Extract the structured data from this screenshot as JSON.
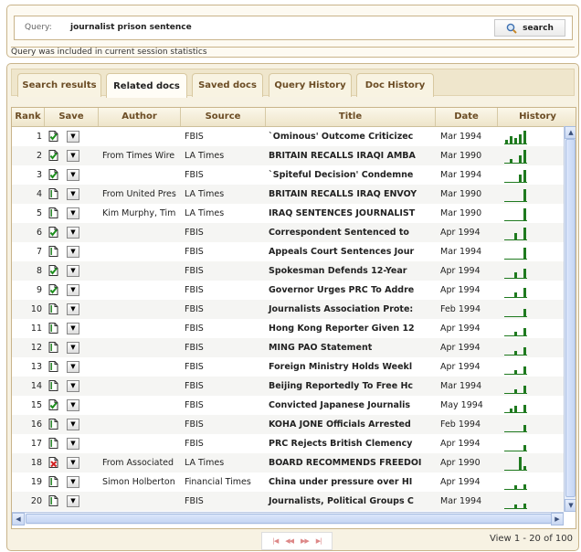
{
  "query": {
    "label": "Query:",
    "value": "journalist prison sentence",
    "search_label": "search",
    "status": "Query was included in current session statistics"
  },
  "tabs": [
    {
      "label": "Search results",
      "active": false
    },
    {
      "label": "Related docs",
      "active": true
    },
    {
      "label": "Saved docs",
      "active": false
    },
    {
      "label": "Query History",
      "active": false
    },
    {
      "label": "Doc History",
      "active": false
    }
  ],
  "columns": [
    "Rank",
    "Save",
    "Author",
    "Source",
    "Title",
    "Date",
    "History"
  ],
  "rows": [
    {
      "rank": "1",
      "saved": "saved",
      "author": "",
      "source": "FBIS",
      "title": "`Ominous' Outcome Criticizec",
      "date": "Mar 1994",
      "history": [
        4,
        8,
        6,
        10,
        14
      ]
    },
    {
      "rank": "2",
      "saved": "saved",
      "author": "From Times Wire",
      "source": "LA Times",
      "title": "BRITAIN RECALLS IRAQI AMBA",
      "date": "Mar 1990",
      "history": [
        0,
        4,
        0,
        8,
        14
      ]
    },
    {
      "rank": "3",
      "saved": "saved",
      "author": "",
      "source": "FBIS",
      "title": "`Spiteful Decision' Condemne",
      "date": "Mar 1994",
      "history": [
        0,
        0,
        0,
        8,
        13
      ]
    },
    {
      "rank": "4",
      "saved": "unsaved",
      "author": "From United Pres",
      "source": "LA Times",
      "title": "BRITAIN RECALLS IRAQ ENVOY",
      "date": "Mar 1990",
      "history": [
        0,
        0,
        0,
        0,
        13
      ]
    },
    {
      "rank": "5",
      "saved": "unsaved",
      "author": "Kim Murphy, Tim",
      "source": "LA Times",
      "title": "IRAQ SENTENCES JOURNALIST",
      "date": "Mar 1990",
      "history": [
        0,
        0,
        0,
        0,
        13
      ]
    },
    {
      "rank": "6",
      "saved": "saved",
      "author": "",
      "source": "FBIS",
      "title": "Correspondent Sentenced to",
      "date": "Apr 1994",
      "history": [
        0,
        0,
        7,
        0,
        13
      ]
    },
    {
      "rank": "7",
      "saved": "unsaved",
      "author": "",
      "source": "FBIS",
      "title": "Appeals Court Sentences Jour",
      "date": "Mar 1994",
      "history": [
        0,
        0,
        0,
        0,
        12
      ]
    },
    {
      "rank": "8",
      "saved": "saved",
      "author": "",
      "source": "FBIS",
      "title": "Spokesman Defends 12-Year",
      "date": "Apr 1994",
      "history": [
        0,
        0,
        6,
        0,
        10
      ]
    },
    {
      "rank": "9",
      "saved": "saved",
      "author": "",
      "source": "FBIS",
      "title": "Governor Urges PRC To Addre",
      "date": "Apr 1994",
      "history": [
        0,
        0,
        5,
        0,
        10
      ]
    },
    {
      "rank": "10",
      "saved": "unsaved",
      "author": "",
      "source": "FBIS",
      "title": "Journalists Association Prote:",
      "date": "Feb 1994",
      "history": [
        0,
        0,
        0,
        0,
        8
      ]
    },
    {
      "rank": "11",
      "saved": "unsaved",
      "author": "",
      "source": "FBIS",
      "title": "Hong Kong Reporter Given 12",
      "date": "Apr 1994",
      "history": [
        0,
        0,
        4,
        0,
        8
      ]
    },
    {
      "rank": "12",
      "saved": "unsaved",
      "author": "",
      "source": "FBIS",
      "title": "MING PAO Statement",
      "date": "Apr 1994",
      "history": [
        0,
        0,
        4,
        0,
        8
      ]
    },
    {
      "rank": "13",
      "saved": "unsaved",
      "author": "",
      "source": "FBIS",
      "title": "Foreign Ministry Holds Weekl",
      "date": "Apr 1994",
      "history": [
        0,
        0,
        4,
        0,
        8
      ]
    },
    {
      "rank": "14",
      "saved": "unsaved",
      "author": "",
      "source": "FBIS",
      "title": "Beijing Reportedly To Free Hc",
      "date": "Mar 1994",
      "history": [
        0,
        0,
        4,
        0,
        8
      ]
    },
    {
      "rank": "15",
      "saved": "saved",
      "author": "",
      "source": "FBIS",
      "title": "Convicted Japanese Journalis",
      "date": "May 1994",
      "history": [
        0,
        4,
        7,
        0,
        8
      ]
    },
    {
      "rank": "16",
      "saved": "unsaved",
      "author": "",
      "source": "FBIS",
      "title": "KOHA JONE Officials Arrested",
      "date": "Feb 1994",
      "history": [
        0,
        0,
        0,
        0,
        7
      ]
    },
    {
      "rank": "17",
      "saved": "unsaved",
      "author": "",
      "source": "FBIS",
      "title": "PRC Rejects British Clemency",
      "date": "Apr 1994",
      "history": [
        0,
        0,
        0,
        0,
        6
      ]
    },
    {
      "rank": "18",
      "saved": "rejected",
      "author": "From Associated",
      "source": "LA Times",
      "title": "BOARD RECOMMENDS FREEDOI",
      "date": "Apr 1990",
      "history": [
        0,
        0,
        0,
        14,
        4
      ]
    },
    {
      "rank": "19",
      "saved": "unsaved",
      "author": "Simon Holberton",
      "source": "Financial Times",
      "title": "China under pressure over HI",
      "date": "Apr 1994",
      "history": [
        0,
        0,
        4,
        0,
        5
      ]
    },
    {
      "rank": "20",
      "saved": "unsaved",
      "author": "",
      "source": "FBIS",
      "title": "Journalists, Political Groups C",
      "date": "Mar 1994",
      "history": [
        0,
        0,
        4,
        0,
        5
      ]
    }
  ],
  "pager": {
    "first": "|◀",
    "prev": "◀◀",
    "next": "▶▶",
    "last": "▶|"
  },
  "view_count": "View 1 - 20 of 100",
  "colors": {
    "spark": "#1f7a1f",
    "accent": "#6b4c24",
    "border": "#c9b48a"
  }
}
